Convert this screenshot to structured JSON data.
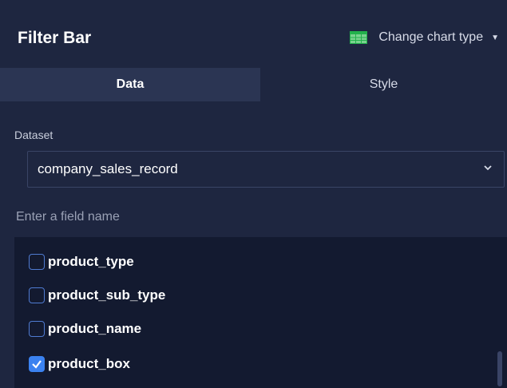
{
  "header": {
    "title": "Filter Bar",
    "change_chart_type_label": "Change chart type",
    "chart_icon": "table-grid-icon"
  },
  "tabs": [
    {
      "label": "Data",
      "active": true
    },
    {
      "label": "Style",
      "active": false
    }
  ],
  "dataset": {
    "label": "Dataset",
    "selected": "company_sales_record"
  },
  "field_search": {
    "placeholder": "Enter a field name",
    "value": ""
  },
  "fields": [
    {
      "name": "product_type",
      "checked": false
    },
    {
      "name": "product_sub_type",
      "checked": false
    },
    {
      "name": "product_name",
      "checked": false
    },
    {
      "name": "product_box",
      "checked": true
    }
  ],
  "colors": {
    "panel_bg": "#1e2640",
    "active_tab_bg": "#2b3553",
    "list_bg": "#131a30",
    "accent": "#3b82f0",
    "chart_icon_green": "#22b14c"
  }
}
